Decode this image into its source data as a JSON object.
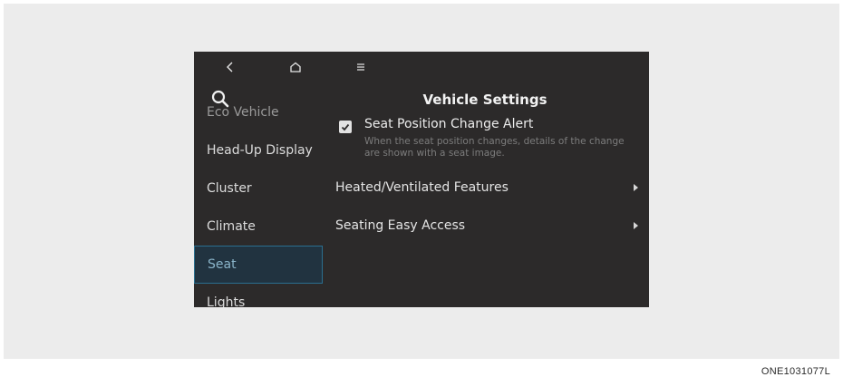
{
  "nav": {
    "back_icon": "chevron-left",
    "home_icon": "home",
    "menu_icon": "hamburger-menu"
  },
  "header": {
    "title": "Vehicle Settings",
    "search_icon": "magnifier"
  },
  "sidebar": {
    "items": [
      {
        "label": "Eco Vehicle",
        "selected": false,
        "partial": true
      },
      {
        "label": "Head-Up Display",
        "selected": false
      },
      {
        "label": "Cluster",
        "selected": false
      },
      {
        "label": "Climate",
        "selected": false
      },
      {
        "label": "Seat",
        "selected": true
      },
      {
        "label": "Lights",
        "selected": false,
        "partial": true
      }
    ]
  },
  "main": {
    "seat_alert": {
      "title": "Seat Position Change Alert",
      "description": "When the seat position changes, details of the change are shown with a seat image.",
      "checked": true
    },
    "menu": [
      {
        "label": "Heated/Ventilated Features",
        "icon": "arrow-right"
      },
      {
        "label": "Seating Easy Access",
        "icon": "arrow-right"
      }
    ]
  },
  "caption": "ONE1031077L",
  "colors": {
    "screen_bg": "#2c2a2a",
    "selected_border": "#2a6f8f",
    "selected_bg": "#213340",
    "page_bg": "#ececec"
  }
}
